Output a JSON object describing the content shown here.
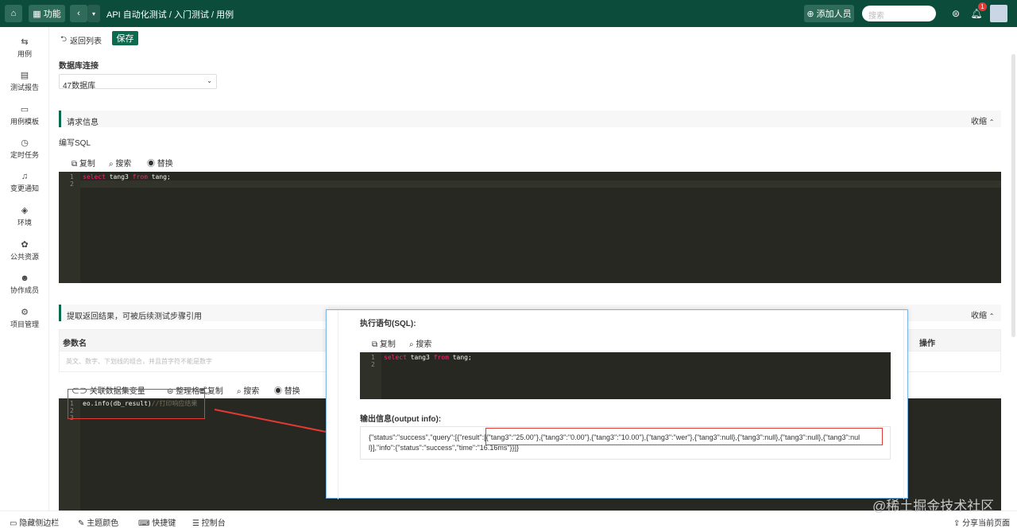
{
  "topbar": {
    "home_icon": "home-icon",
    "func_label": "功能",
    "breadcrumb": "API 自动化测试 / 入门测试 / 用例",
    "add_member": "添加人员",
    "search_placeholder": "搜索",
    "notification_count": "1",
    "colors": {
      "bg": "#0b4d3a",
      "accent": "#0b6b4f"
    }
  },
  "sidebar": {
    "items": [
      {
        "icon": "case-icon",
        "label": "用例"
      },
      {
        "icon": "report-icon",
        "label": "测试报告"
      },
      {
        "icon": "template-icon",
        "label": "用例模板"
      },
      {
        "icon": "clock-icon",
        "label": "定时任务"
      },
      {
        "icon": "bell-icon",
        "label": "变更通知"
      },
      {
        "icon": "env-icon",
        "label": "环境"
      },
      {
        "icon": "resource-icon",
        "label": "公共资源"
      },
      {
        "icon": "member-icon",
        "label": "协作成员"
      },
      {
        "icon": "settings-icon",
        "label": "项目管理"
      }
    ]
  },
  "toolbar": {
    "back_label": "返回列表",
    "save_label": "保存"
  },
  "db": {
    "label": "数据库连接",
    "selected": "47数据库"
  },
  "request": {
    "section_title": "请求信息",
    "collapse": "收缩",
    "sql_label": "编写SQL",
    "tools": [
      "复制",
      "搜索",
      "替换"
    ],
    "code_kw1": "select",
    "code_mid": " tang3 ",
    "code_kw2": "from",
    "code_end": " tang;",
    "lines": [
      "1",
      "2"
    ]
  },
  "extract": {
    "section_title": "提取返回结果，可被后续测试步骤引用",
    "collapse": "收缩",
    "col_param": "参数名",
    "col_action": "操作",
    "param_placeholder": "英文、数字、下划线的组合，并且首字符不能是数字",
    "tools": [
      "关联数据集变量",
      "整理格式",
      "复制",
      "搜索",
      "替换"
    ],
    "code_main": "eo.info(db_result)",
    "code_comment": "//打印响应结果",
    "lines": [
      "1",
      "2",
      "3"
    ]
  },
  "modal": {
    "exec_label": "执行语句(SQL):",
    "tools": [
      "复制",
      "搜索"
    ],
    "code_kw1": "select",
    "code_mid": " tang3 ",
    "code_kw2": "from",
    "code_end": " tang;",
    "lines": [
      "1",
      "2"
    ],
    "output_label": "输出信息(output info):",
    "output_line1": "{\"status\":\"success\",\"query\":[{\"result\":[{\"tang3\":\"25.00\"},{\"tang3\":\"0.00\"},{\"tang3\":\"10.00\"},{\"tang3\":\"wer\"},{\"tang3\":null},{\"tang3\":null},{\"tang3\":null},{\"tang3\":nul",
    "output_line2": "l}],\"info\":{\"status\":\"success\",\"time\":\"16.16ms\"}}]}"
  },
  "footer": {
    "items": [
      "隐藏侧边栏",
      "主题颜色",
      "快捷键",
      "控制台"
    ],
    "share": "分享当前页面",
    "watermark": "@稀土掘金技术社区"
  }
}
